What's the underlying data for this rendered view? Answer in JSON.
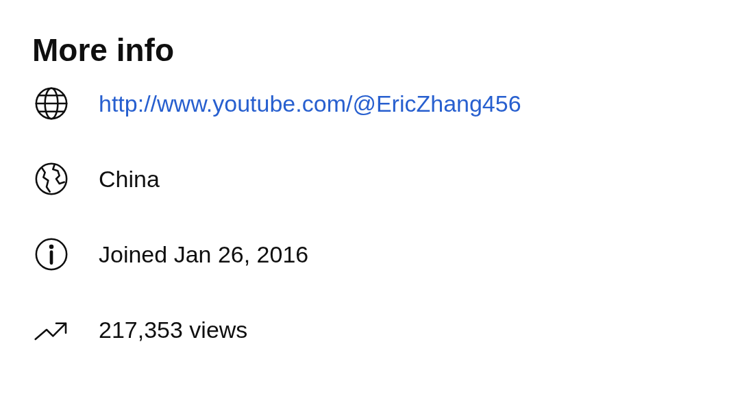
{
  "title": "More info",
  "rows": [
    {
      "kind": "link",
      "text": "http://www.youtube.com/@EricZhang456"
    },
    {
      "kind": "country",
      "text": "China"
    },
    {
      "kind": "joined",
      "text": "Joined Jan 26, 2016"
    },
    {
      "kind": "views",
      "text": "217,353 views"
    }
  ]
}
